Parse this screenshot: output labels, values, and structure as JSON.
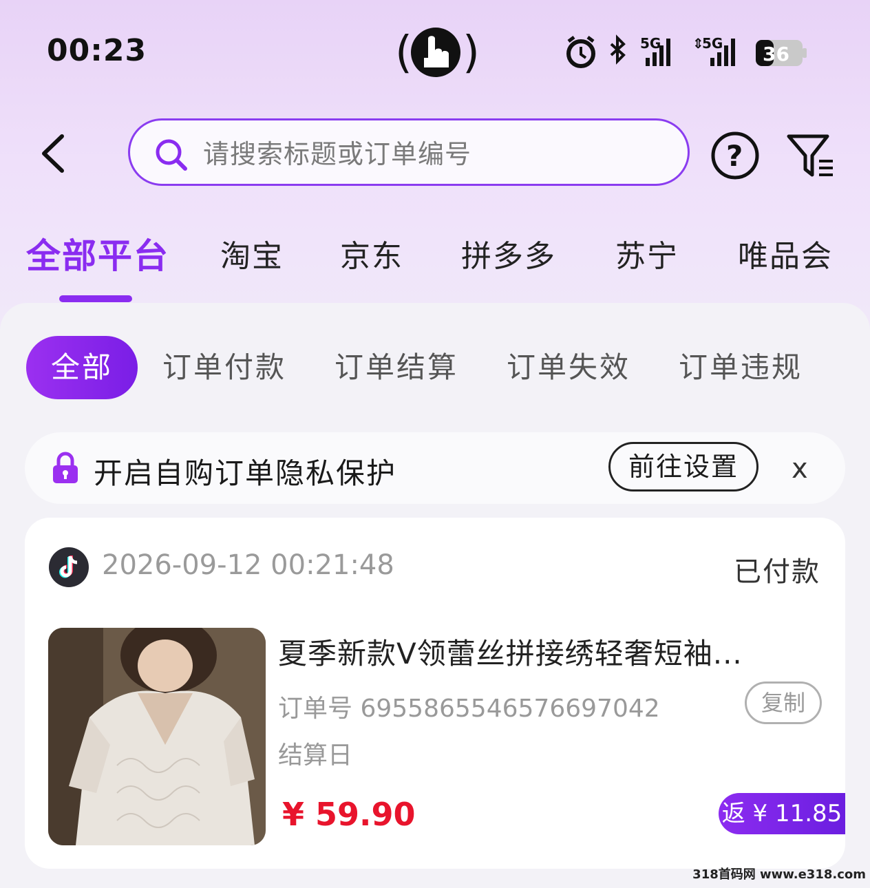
{
  "status_bar": {
    "time": "00:23",
    "network_1": "5G",
    "network_2": "5G",
    "battery": "36"
  },
  "header": {
    "search_placeholder": "请搜索标题或订单编号"
  },
  "platform_tabs": [
    {
      "label": "全部平台",
      "active": true
    },
    {
      "label": "淘宝",
      "active": false
    },
    {
      "label": "京东",
      "active": false
    },
    {
      "label": "拼多多",
      "active": false
    },
    {
      "label": "苏宁",
      "active": false
    },
    {
      "label": "唯品会",
      "active": false
    }
  ],
  "status_filters": [
    {
      "label": "全部",
      "active": true
    },
    {
      "label": "订单付款",
      "active": false
    },
    {
      "label": "订单结算",
      "active": false
    },
    {
      "label": "订单失效",
      "active": false
    },
    {
      "label": "订单违规",
      "active": false
    }
  ],
  "privacy_banner": {
    "text": "开启自购订单隐私保护",
    "button_label": "前往设置",
    "close_label": "x"
  },
  "order": {
    "time": "2026-09-12 00:21:48",
    "status": "已付款",
    "title": "夏季新款V领蕾丝拼接绣轻奢短袖...",
    "order_number_label": "订单号",
    "order_number": "6955865546576697042",
    "copy_label": "复制",
    "settle_label": "结算日",
    "price": "¥ 59.90",
    "rebate": "返 ¥ 11.85"
  },
  "watermark": "318首码网 www.e318.com",
  "colors": {
    "accent": "#8a2cf0",
    "price": "#e8142c"
  }
}
